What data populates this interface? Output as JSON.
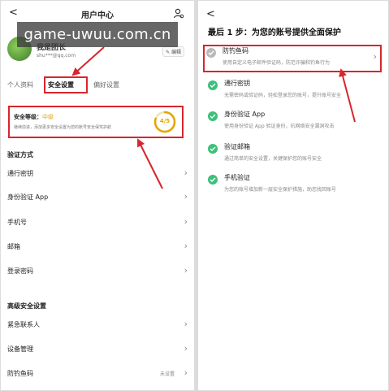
{
  "left": {
    "title": "用户中心",
    "back": "<",
    "profile": {
      "nickname": "我是团长",
      "email": "shu***@qq.com",
      "edit": "✎ 编辑"
    },
    "tabs": [
      "个人资料",
      "安全设置",
      "偏好设置"
    ],
    "active_tab": "安全设置",
    "security": {
      "label": "安全等级：",
      "level": "中级",
      "desc": "继续前进，添加更多安全设置为您的账号安全保驾护航",
      "score": "4/5",
      "score_fraction": 0.8
    },
    "verification_header": "验证方式",
    "verification_items": [
      "通行密钥",
      "身份验证 App",
      "手机号",
      "邮箱",
      "登录密码"
    ],
    "advanced_header": "高级安全设置",
    "advanced_items": [
      {
        "label": "紧急联系人",
        "value": ""
      },
      {
        "label": "设备管理",
        "value": ""
      },
      {
        "label": "防钓鱼码",
        "value": "未设置"
      }
    ]
  },
  "right": {
    "back": "<",
    "title": "最后 1 步：为您的账号提供全面保护",
    "items": [
      {
        "title": "防钓鱼码",
        "desc": "使用自定义电子邮件验证码，防范诈骗和钓鱼行为"
      },
      {
        "title": "通行密钥",
        "desc": "无需密码或验证码，轻松登录您的账号，提升账号安全"
      },
      {
        "title": "身份验证 App",
        "desc": "使用身份验证 App 验证身份，抗网络安全漏洞攻击"
      },
      {
        "title": "验证邮箱",
        "desc": "通过简单的安全设置，关键保护您的账号安全"
      },
      {
        "title": "手机验证",
        "desc": "为您的账号增加新一层安全保护措施，助您找回账号"
      }
    ]
  },
  "watermark": "game-uwuu.com.cn",
  "colors": {
    "highlight_red": "#d7262c",
    "accent_green": "#3cc07a",
    "level_gold": "#e3a500"
  }
}
